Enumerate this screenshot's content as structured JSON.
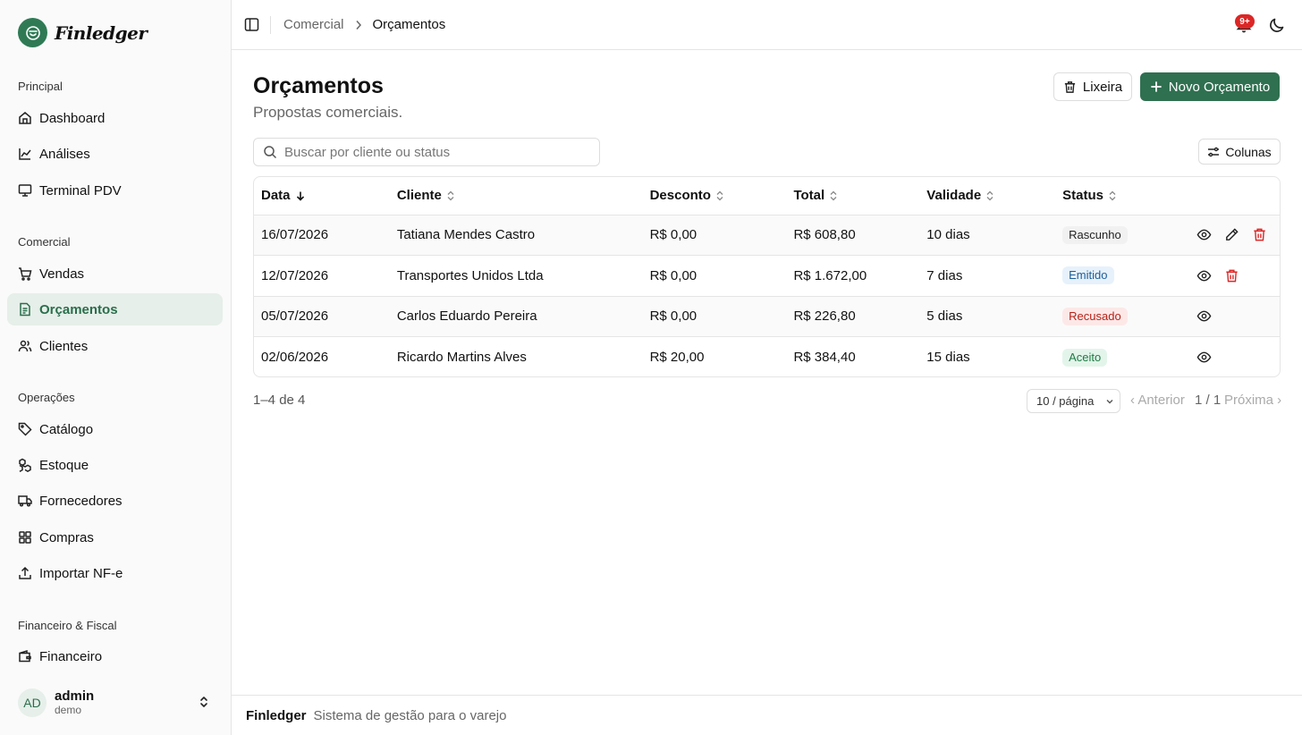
{
  "app": {
    "name": "Finledger"
  },
  "sidebar": {
    "sections": [
      {
        "title": "Principal",
        "items": [
          {
            "label": "Dashboard",
            "icon": "home-icon"
          },
          {
            "label": "Análises",
            "icon": "line-chart-icon"
          },
          {
            "label": "Terminal PDV",
            "icon": "monitor-icon"
          }
        ]
      },
      {
        "title": "Comercial",
        "items": [
          {
            "label": "Vendas",
            "icon": "cart-icon"
          },
          {
            "label": "Orçamentos",
            "icon": "file-icon",
            "active": true
          },
          {
            "label": "Clientes",
            "icon": "users-icon"
          }
        ]
      },
      {
        "title": "Operações",
        "items": [
          {
            "label": "Catálogo",
            "icon": "tag-icon"
          },
          {
            "label": "Estoque",
            "icon": "boxes-icon"
          },
          {
            "label": "Fornecedores",
            "icon": "truck-icon"
          },
          {
            "label": "Compras",
            "icon": "grid-icon"
          },
          {
            "label": "Importar NF-e",
            "icon": "upload-icon"
          }
        ]
      },
      {
        "title": "Financeiro & Fiscal",
        "items": [
          {
            "label": "Financeiro",
            "icon": "wallet-icon"
          }
        ]
      }
    ],
    "user": {
      "initials": "AD",
      "name": "admin",
      "role": "demo"
    }
  },
  "header": {
    "breadcrumb": {
      "parent": "Comercial",
      "current": "Orçamentos"
    },
    "notifications": "9+"
  },
  "main": {
    "title": "Orçamentos",
    "subtitle": "Propostas comerciais.",
    "trash_label": "Lixeira",
    "new_label": "Novo Orçamento",
    "search_placeholder": "Buscar por cliente ou status",
    "columns_label": "Colunas",
    "table": {
      "headers": [
        "Data",
        "Cliente",
        "Desconto",
        "Total",
        "Validade",
        "Status"
      ],
      "rows": [
        {
          "date": "16/07/2026",
          "client": "Tatiana Mendes Castro",
          "discount": "R$ 0,00",
          "total": "R$ 608,80",
          "validity": "10 dias",
          "status": "Rascunho",
          "status_kind": "draft",
          "actions": [
            "view",
            "edit",
            "delete"
          ]
        },
        {
          "date": "12/07/2026",
          "client": "Transportes Unidos Ltda",
          "discount": "R$ 0,00",
          "total": "R$ 1.672,00",
          "validity": "7 dias",
          "status": "Emitido",
          "status_kind": "issued",
          "actions": [
            "view",
            "delete"
          ]
        },
        {
          "date": "05/07/2026",
          "client": "Carlos Eduardo Pereira",
          "discount": "R$ 0,00",
          "total": "R$ 226,80",
          "validity": "5 dias",
          "status": "Recusado",
          "status_kind": "refused",
          "actions": [
            "view"
          ]
        },
        {
          "date": "02/06/2026",
          "client": "Ricardo Martins Alves",
          "discount": "R$ 20,00",
          "total": "R$ 384,40",
          "validity": "15 dias",
          "status": "Aceito",
          "status_kind": "accepted",
          "actions": [
            "view"
          ]
        }
      ]
    },
    "pagination": {
      "count": "1–4 de 4",
      "page_size": "10 / página",
      "prev": "‹ Anterior",
      "info": "1 / 1",
      "next": "Próxima ›"
    }
  },
  "footer": {
    "brand": "Finledger",
    "tagline": "Sistema de gestão para o varejo"
  },
  "colors": {
    "primary": "#2f7050",
    "active_bg": "#e6efe9",
    "danger": "#dc2626"
  }
}
